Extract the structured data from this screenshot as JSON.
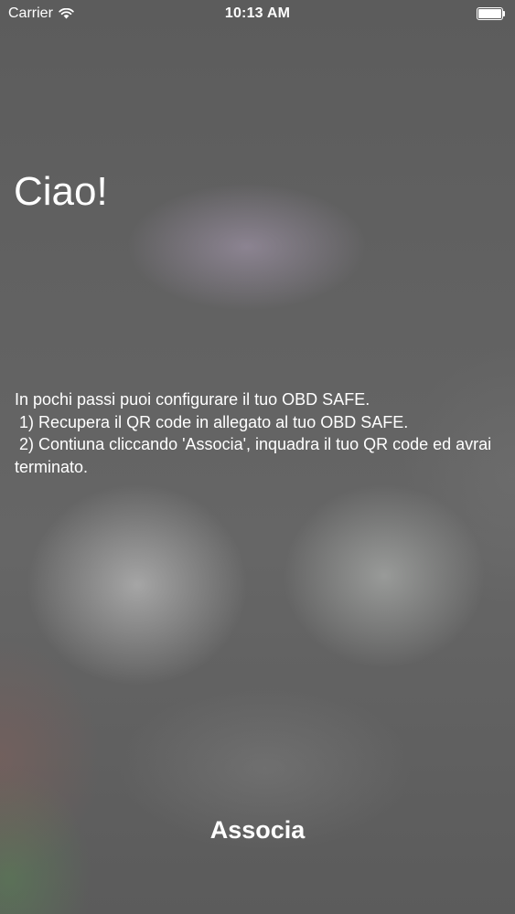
{
  "status_bar": {
    "carrier": "Carrier",
    "time": "10:13 AM",
    "battery_level": 1.0,
    "icons": [
      "wifi-icon",
      "battery-icon"
    ]
  },
  "main": {
    "greeting": "Ciao!",
    "instructions": [
      "In pochi passi puoi configurare il tuo OBD SAFE.",
      " 1) Recupera il QR code in allegato al tuo OBD SAFE.",
      " 2) Contiuna cliccando 'Associa', inquadra il tuo QR code ed avrai terminato."
    ]
  },
  "actions": {
    "associate_label": "Associa"
  },
  "colors": {
    "text": "#ffffff",
    "background": "#5f5f5f"
  }
}
